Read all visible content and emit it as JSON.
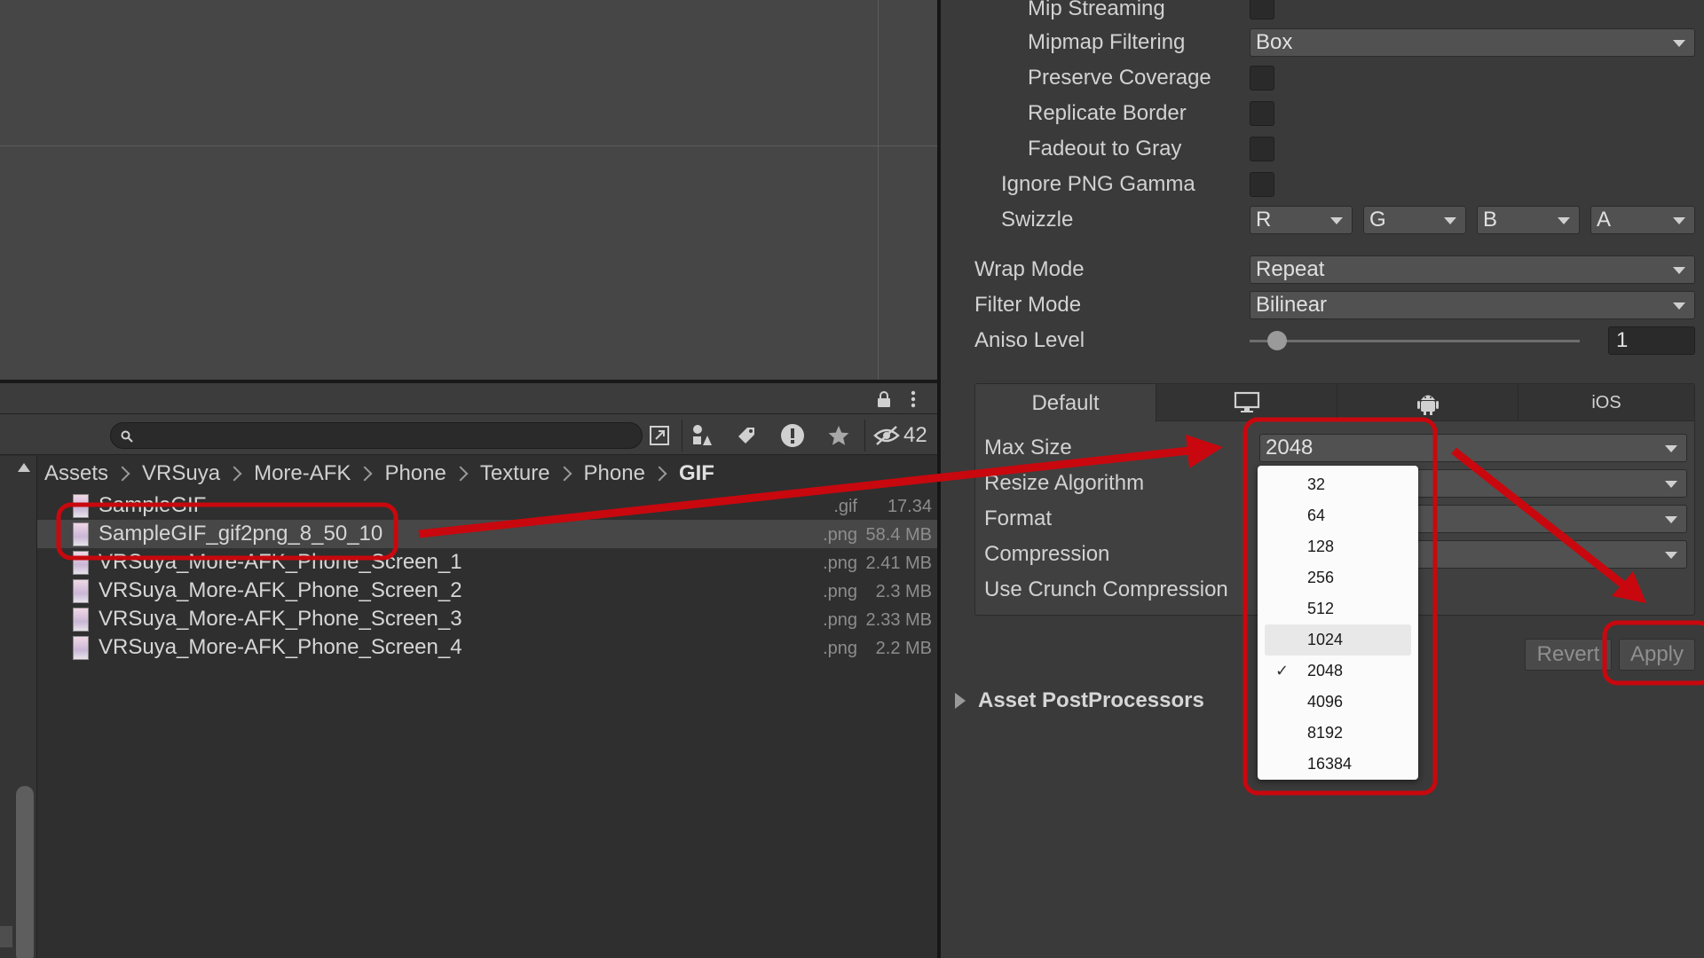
{
  "colors": {
    "annotation_red": "#c8080e",
    "panel_bg": "#3a3a3a",
    "scene_bg": "#464646",
    "project_bg": "#2f2f2f"
  },
  "project": {
    "hidden_count": "42",
    "breadcrumb": [
      "Assets",
      "VRSuya",
      "More-AFK",
      "Phone",
      "Texture",
      "Phone",
      "GIF"
    ],
    "files": [
      {
        "name": "SampleGIF",
        "ext": ".gif",
        "size": "17.34 MB"
      },
      {
        "name": "SampleGIF_gif2png_8_50_10",
        "ext": ".png",
        "size": "58.4 MB"
      },
      {
        "name": "VRSuya_More-AFK_Phone_Screen_1",
        "ext": ".png",
        "size": "2.41 MB"
      },
      {
        "name": "VRSuya_More-AFK_Phone_Screen_2",
        "ext": ".png",
        "size": "2.3 MB"
      },
      {
        "name": "VRSuya_More-AFK_Phone_Screen_3",
        "ext": ".png",
        "size": "2.33 MB"
      },
      {
        "name": "VRSuya_More-AFK_Phone_Screen_4",
        "ext": ".png",
        "size": "2.2 MB"
      }
    ],
    "icons": [
      "lock-icon",
      "kebab-menu-icon",
      "search-icon",
      "open-external-icon",
      "filter-by-type-icon",
      "label-icon",
      "warning-icon",
      "favorite-star-icon",
      "hidden-eye-icon"
    ]
  },
  "inspector": {
    "labels": {
      "mip_streaming": "Mip Streaming",
      "mipmap_filtering": "Mipmap Filtering",
      "preserve_coverage": "Preserve Coverage",
      "replicate_border": "Replicate Border",
      "fadeout_to_gray": "Fadeout to Gray",
      "ignore_png_gamma": "Ignore PNG Gamma",
      "swizzle": "Swizzle",
      "wrap_mode": "Wrap Mode",
      "filter_mode": "Filter Mode",
      "aniso_level": "Aniso Level"
    },
    "values": {
      "mipmap_filtering": "Box",
      "swizzle_r": "R",
      "swizzle_g": "G",
      "swizzle_b": "B",
      "swizzle_a": "A",
      "wrap_mode": "Repeat",
      "filter_mode": "Bilinear",
      "aniso_level": "1"
    },
    "platform_tabs": {
      "default": "Default",
      "ios": "iOS",
      "standalone_icon": "monitor-icon",
      "android_icon": "android-icon"
    },
    "platform": {
      "max_size_label": "Max Size",
      "max_size_value": "2048",
      "resize_algorithm_label": "Resize Algorithm",
      "format_label": "Format",
      "compression_label": "Compression",
      "crunch_label": "Use Crunch Compression"
    },
    "revert_label": "Revert",
    "apply_label": "Apply",
    "foldout_label": "Asset PostProcessors"
  },
  "max_size_menu": {
    "options": [
      "32",
      "64",
      "128",
      "256",
      "512",
      "1024",
      "2048",
      "4096",
      "8192",
      "16384"
    ],
    "selected": "2048",
    "hovered": "1024"
  }
}
